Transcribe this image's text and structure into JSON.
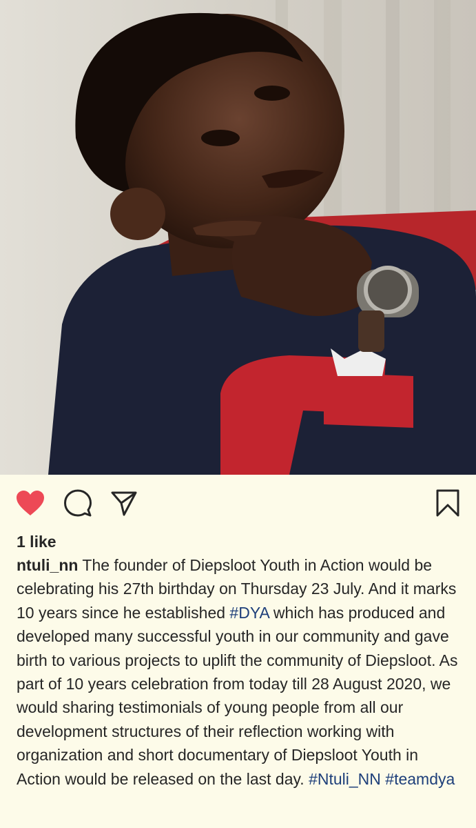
{
  "post": {
    "photo_description_icon": "portrait-photo",
    "likes_label": "1 like",
    "username": "ntuli_nn",
    "caption_parts": [
      {
        "type": "text",
        "value": " The founder of Diepsloot Youth in Action would be celebrating his 27th birthday on Thursday 23 July. And it marks 10 years since he established "
      },
      {
        "type": "tag",
        "value": "#DYA"
      },
      {
        "type": "text",
        "value": " which has produced and developed many successful youth in our community and gave birth to various projects to uplift the community of Diepsloot. As part of 10 years celebration from today till 28 August 2020, we would sharing testimonials of young people from all our development structures of their reflection working with organization and short documentary of Diepsloot Youth in Action would be released on the last day. "
      },
      {
        "type": "tag",
        "value": "#Ntuli_NN"
      },
      {
        "type": "text",
        "value": " "
      },
      {
        "type": "tag",
        "value": "#teamdya"
      }
    ],
    "liked": true
  },
  "icons": {
    "like": "heart-icon",
    "comment": "comment-icon",
    "share": "share-icon",
    "save": "bookmark-icon"
  },
  "colors": {
    "background": "#fdfbe9",
    "heart": "#ed4956",
    "hashtag": "#1e3f7a",
    "text": "#262626"
  }
}
